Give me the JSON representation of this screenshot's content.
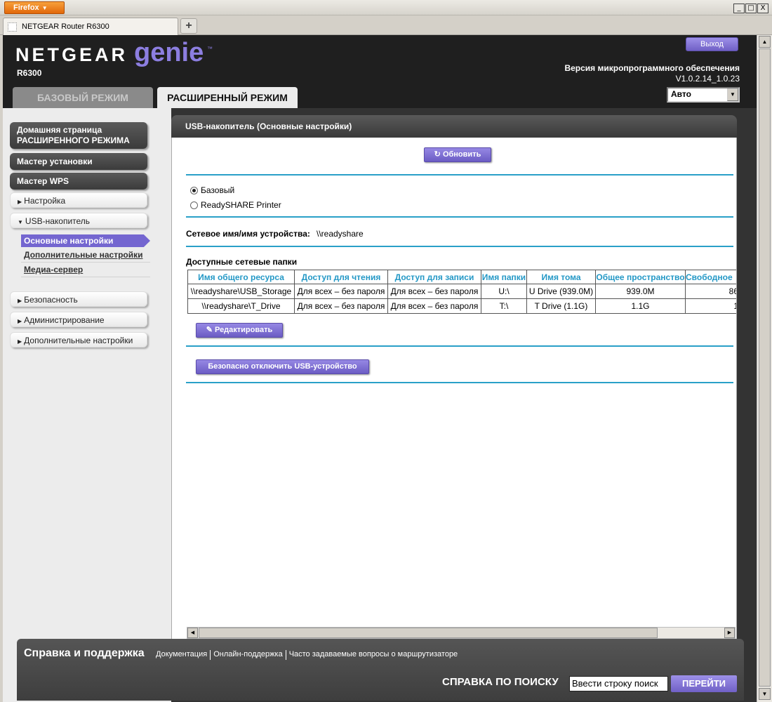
{
  "browser": {
    "menu_label": "Firefox",
    "tab_title": "NETGEAR Router R6300",
    "new_tab": "+",
    "win_min": "_",
    "win_max": "□",
    "win_close": "X"
  },
  "header": {
    "brand": "NETGEAR",
    "product": "genie",
    "tm": "™",
    "model": "R6300",
    "logout_label": "Выход",
    "firmware_title": "Версия микропрограммного обеспечения",
    "firmware_version": "V1.0.2.14_1.0.23",
    "tab_basic": "БАЗОВЫЙ РЕЖИМ",
    "tab_advanced": "РАСШИРЕННЫЙ РЕЖИМ",
    "language_value": "Авто"
  },
  "sidebar": {
    "home_line1": "Домашняя страница",
    "home_line2": "РАСШИРЕННОГО РЕЖИМА",
    "setup_wizard": "Мастер установки",
    "wps_wizard": "Мастер WPS",
    "setup": "Настройка",
    "usb_storage": "USB-накопитель",
    "usb_basic": "Основные настройки",
    "usb_advanced": "Дополнительные настройки",
    "media_server": "Медиа-сервер",
    "security": "Безопасность",
    "administration": "Администрирование",
    "advanced_setup": "Дополнительные настройки"
  },
  "main": {
    "title": "USB-накопитель (Основные настройки)",
    "refresh_label": "Обновить",
    "radio_basic": "Базовый",
    "radio_printer": "ReadySHARE Printer",
    "network_name_label": "Сетевое имя/имя устройства:",
    "network_name_value": "\\\\readyshare",
    "folders_label": "Доступные сетевые папки",
    "table": {
      "headers": [
        "Имя общего ресурса",
        "Доступ для чтения",
        "Доступ для записи",
        "Имя папки",
        "Имя тома",
        "Общее пространство",
        "Свободное"
      ],
      "rows": [
        [
          "\\\\readyshare\\USB_Storage",
          "Для всех – без пароля",
          "Для всех – без пароля",
          "U:\\",
          "U Drive (939.0M)",
          "939.0M",
          "86"
        ],
        [
          "\\\\readyshare\\T_Drive",
          "Для всех – без пароля",
          "Для всех – без пароля",
          "T:\\",
          "T Drive (1.1G)",
          "1.1G",
          "1"
        ]
      ]
    },
    "edit_label": "Редактировать",
    "eject_label": "Безопасно отключить USB-устройство"
  },
  "footer": {
    "help_title": "Справка и поддержка",
    "link_docs": "Документация",
    "link_online": "Онлайн-поддержка",
    "link_faq": "Часто задаваемые вопросы о маршрутизаторе",
    "search_label": "СПРАВКА ПО ПОИСКУ",
    "search_placeholder": "Ввести строку поиск",
    "search_button": "ПЕРЕЙТИ"
  },
  "colors": {
    "accent_purple": "#7466d0",
    "divider_blue": "#2aa0c8",
    "header_dark": "#1f1f1f"
  }
}
